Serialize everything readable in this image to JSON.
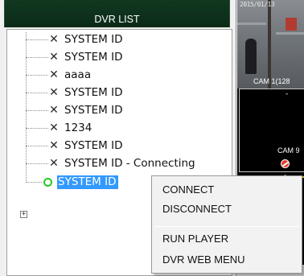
{
  "dvr_list": {
    "title": "DVR LIST",
    "items": [
      {
        "label": "SYSTEM ID",
        "status_icon": "disconnected-x-icon"
      },
      {
        "label": "SYSTEM ID",
        "status_icon": "disconnected-x-icon"
      },
      {
        "label": "aaaa",
        "status_icon": "disconnected-x-icon"
      },
      {
        "label": "SYSTEM ID",
        "status_icon": "disconnected-x-icon"
      },
      {
        "label": "SYSTEM ID",
        "status_icon": "disconnected-x-icon"
      },
      {
        "label": "1234",
        "status_icon": "disconnected-x-icon"
      },
      {
        "label": "SYSTEM ID",
        "status_icon": "disconnected-x-icon"
      },
      {
        "label": "SYSTEM ID - Connecting",
        "status_icon": "disconnected-x-icon"
      },
      {
        "label": "SYSTEM ID",
        "status_icon": "connected-circle-icon",
        "selected": true,
        "expandable": true
      }
    ],
    "expander_symbol": "+"
  },
  "camera_view": {
    "timestamp": "2015/01/13",
    "cam1_label": "CAM 1(128",
    "cam_other_label": "CAM 9",
    "dash": "-"
  },
  "context_menu": {
    "items": [
      "CONNECT",
      "DISCONNECT",
      "RUN PLAYER",
      "DVR WEB MENU"
    ]
  },
  "colors": {
    "header_bg": "#0b2b17",
    "selection": "#3399ff",
    "connected": "#22cc22",
    "no_signal": "#e23b2b",
    "active_tile_border": "#d9c234"
  }
}
